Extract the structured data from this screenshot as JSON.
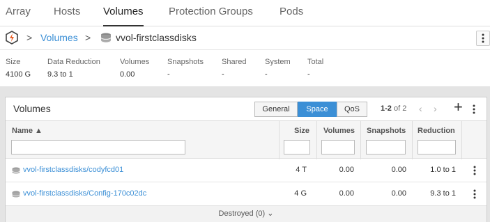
{
  "nav": {
    "tabs": [
      "Array",
      "Hosts",
      "Volumes",
      "Protection Groups",
      "Pods"
    ],
    "active": "Volumes"
  },
  "breadcrumb": {
    "sep1": ">",
    "link": "Volumes",
    "sep2": ">",
    "current": "vvol-firstclassdisks"
  },
  "stats": {
    "headers": [
      "Size",
      "Data Reduction",
      "Volumes",
      "Snapshots",
      "Shared",
      "System",
      "Total"
    ],
    "values": [
      "4100 G",
      "9.3 to 1",
      "0.00",
      "-",
      "-",
      "-",
      "-"
    ]
  },
  "panel": {
    "title": "Volumes",
    "segments": [
      "General",
      "Space",
      "QoS"
    ],
    "active_segment": "Space",
    "pager_range": "1-2",
    "pager_of": "of 2",
    "prev_icon": "chevron-left-icon",
    "next_icon": "chevron-right-icon",
    "add_label": "+"
  },
  "table": {
    "columns": [
      "Name ▲",
      "Size",
      "Volumes",
      "Snapshots",
      "Reduction"
    ],
    "rows": [
      {
        "name": "vvol-firstclassdisks/codyfcd01",
        "size": "4 T",
        "volumes": "0.00",
        "snapshots": "0.00",
        "reduction": "1.0 to 1"
      },
      {
        "name": "vvol-firstclassdisks/Config-170c02dc",
        "size": "4 G",
        "volumes": "0.00",
        "snapshots": "0.00",
        "reduction": "9.3 to 1"
      }
    ],
    "footer": "Destroyed (0)",
    "footer_icon": "⌄"
  },
  "colors": {
    "accent": "#3b8fd6",
    "logo": "#e9622b"
  }
}
